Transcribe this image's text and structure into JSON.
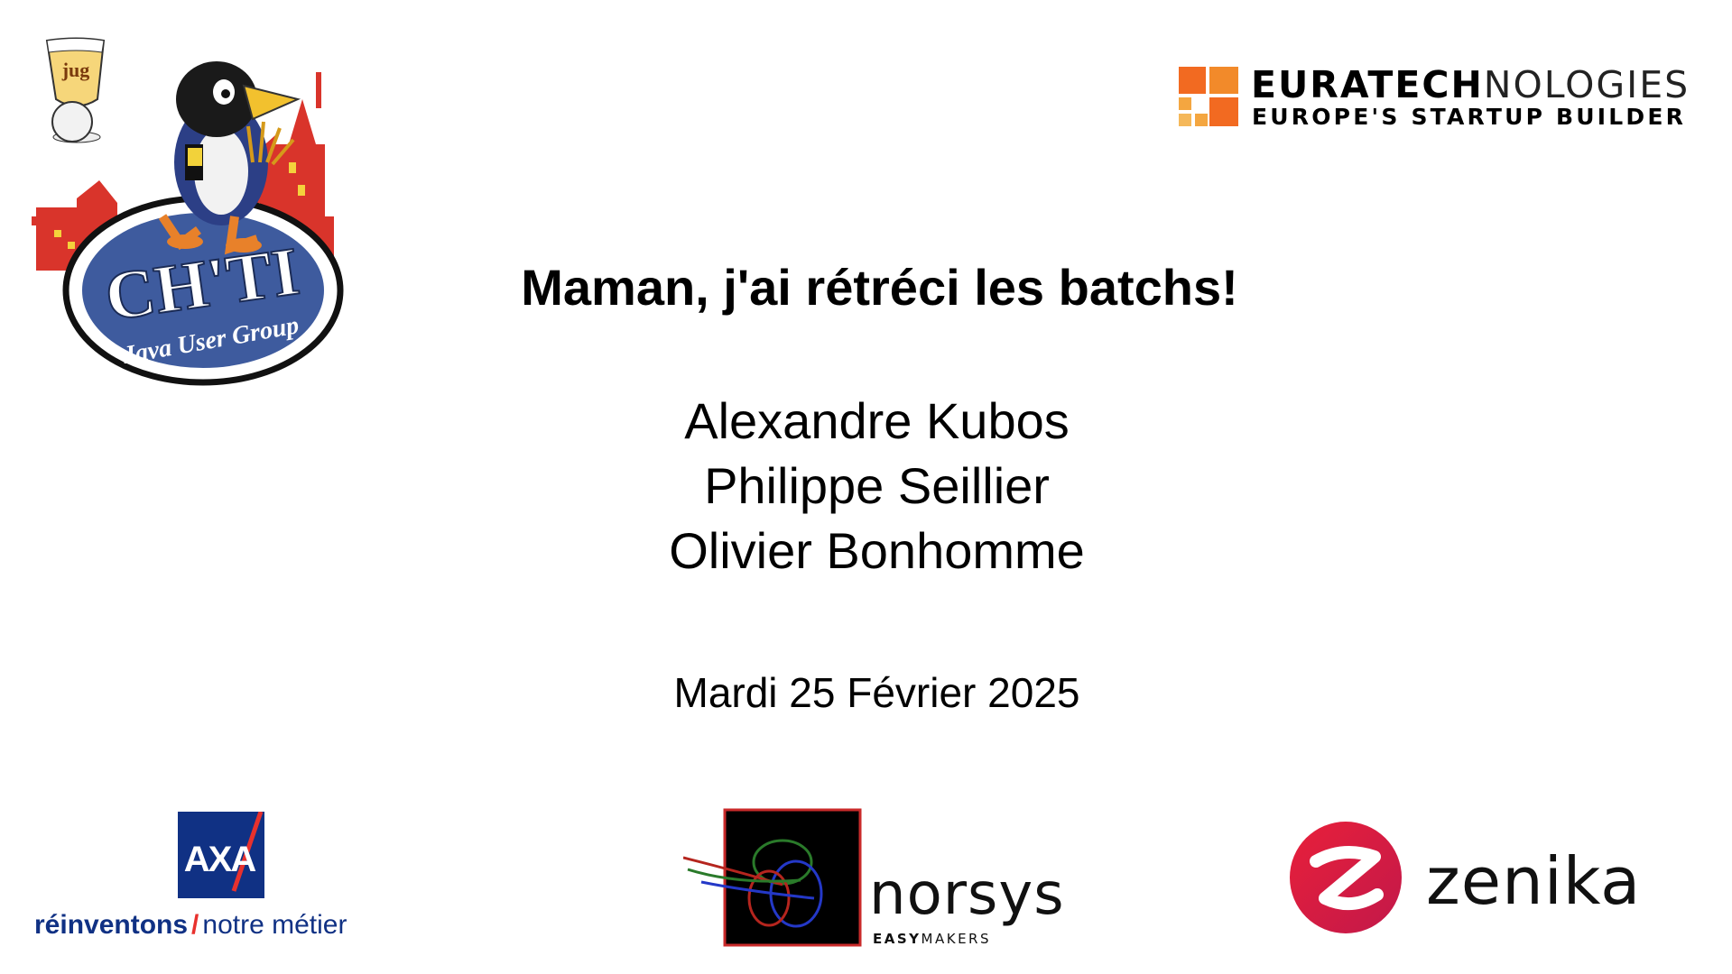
{
  "title": "Maman, j'ai rétréci les batchs!",
  "speakers": [
    "Alexandre Kubos",
    "Philippe Seillier",
    "Olivier Bonhomme"
  ],
  "date": "Mardi 25 Février 2025",
  "logos": {
    "chtijug": {
      "glass_text": "jug",
      "main_text": "CH'TI",
      "sub_text": "Java User Group"
    },
    "euratech": {
      "line1_bold": "EURATECH",
      "line1_light": "NOLOGIES",
      "line2": "EUROPE'S STARTUP BUILDER",
      "color": "#f26a21"
    },
    "axa": {
      "mark": "AXA",
      "tagline_bold": "réinventons",
      "tagline_slash": "/",
      "tagline_normal": "notre métier",
      "color": "#103184",
      "accent": "#e8312d"
    },
    "norsys": {
      "word": "norsys",
      "sub_bold": "EASY",
      "sub_normal": "MAKERS"
    },
    "zenika": {
      "word": "zenika",
      "color": "#e0263c"
    }
  }
}
